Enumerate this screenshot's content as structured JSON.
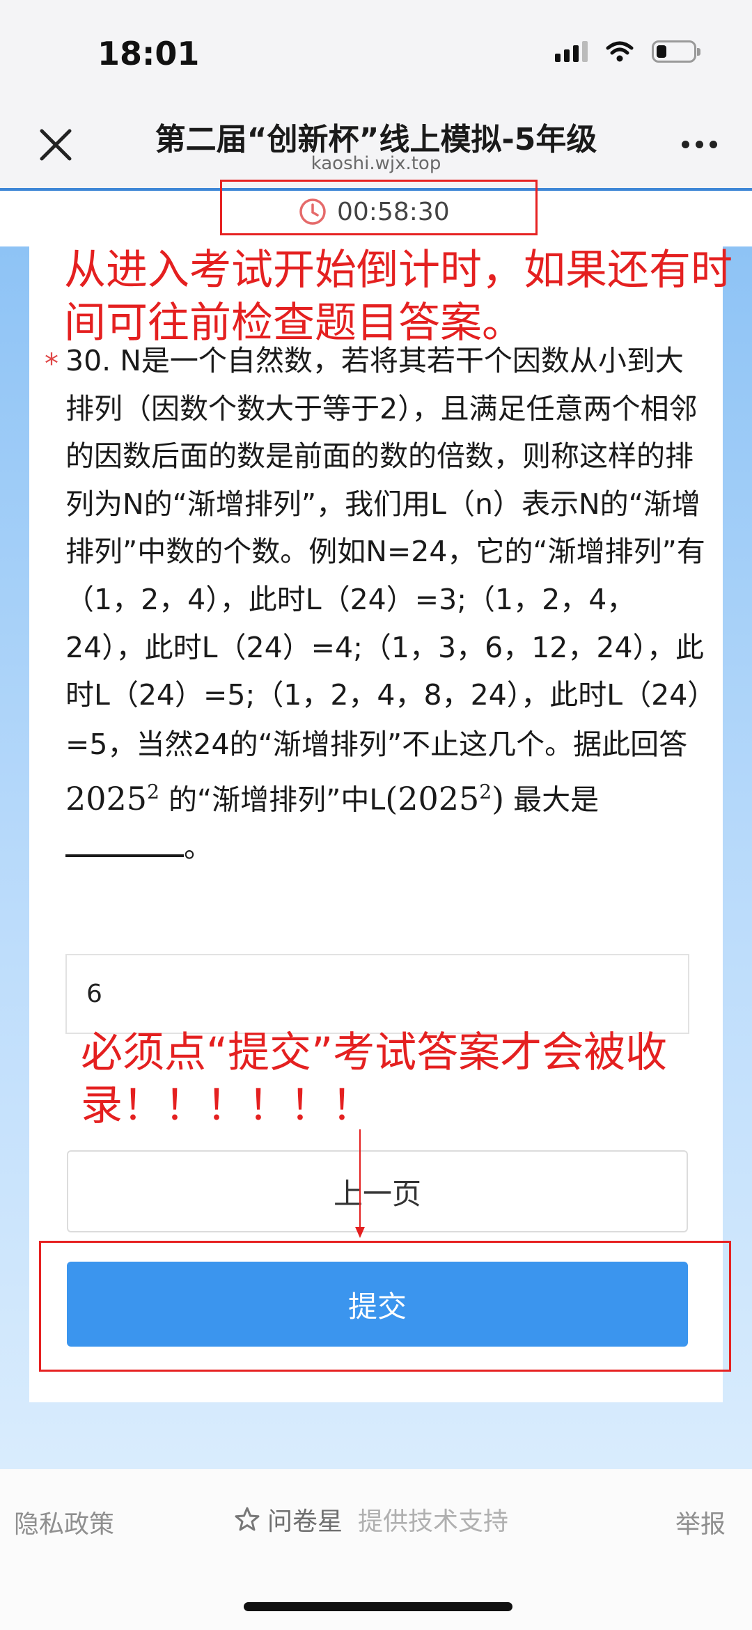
{
  "status_bar": {
    "time": "18:01"
  },
  "nav": {
    "title": "第二届“创新杯”线上模拟-5年级",
    "url": "kaoshi.wjx.top"
  },
  "timer": {
    "value": "00:58:30"
  },
  "annotations": {
    "top": "从进入考试开始倒计时，如果还有时间可往前检查题目答案。",
    "middle": "必须点“提交”考试答案才会被收录！！！！！！"
  },
  "question": {
    "required_mark": "*",
    "text": "30. N是一个自然数，若将其若干个因数从小到大排列（因数个数大于等于2），且满足任意两个相邻的因数后面的数是前面的数的倍数，则称这样的排列为N的“渐增排列”，我们用L（n）表示N的“渐增排列”中数的个数。例如N=24，它的“渐增排列”有（1，2，4），此时L（24）=3;（1，2，4，24），此时L（24）=4;（1，3，6，12，24），此时L（24）=5;（1，2，4，8，24），此时L（24）=5，当然24的“渐增排列”不止这几个。据此回答",
    "math1_base": "2025",
    "math1_exp": "2",
    "text2": " 的“渐增排列”中L",
    "math2_open": "(",
    "math2_base": "2025",
    "math2_exp": "2",
    "math2_close": ")",
    "text3": " 最大是",
    "text4": "。"
  },
  "answer": {
    "value": "6"
  },
  "buttons": {
    "prev": "上一页",
    "submit": "提交"
  },
  "footer": {
    "privacy": "隐私政策",
    "brand": "问卷星",
    "support": "提供技术支持",
    "report": "举报"
  },
  "colors": {
    "accent": "#3b95ee",
    "annotation": "#e42020",
    "nav_border": "#3d86d6"
  }
}
